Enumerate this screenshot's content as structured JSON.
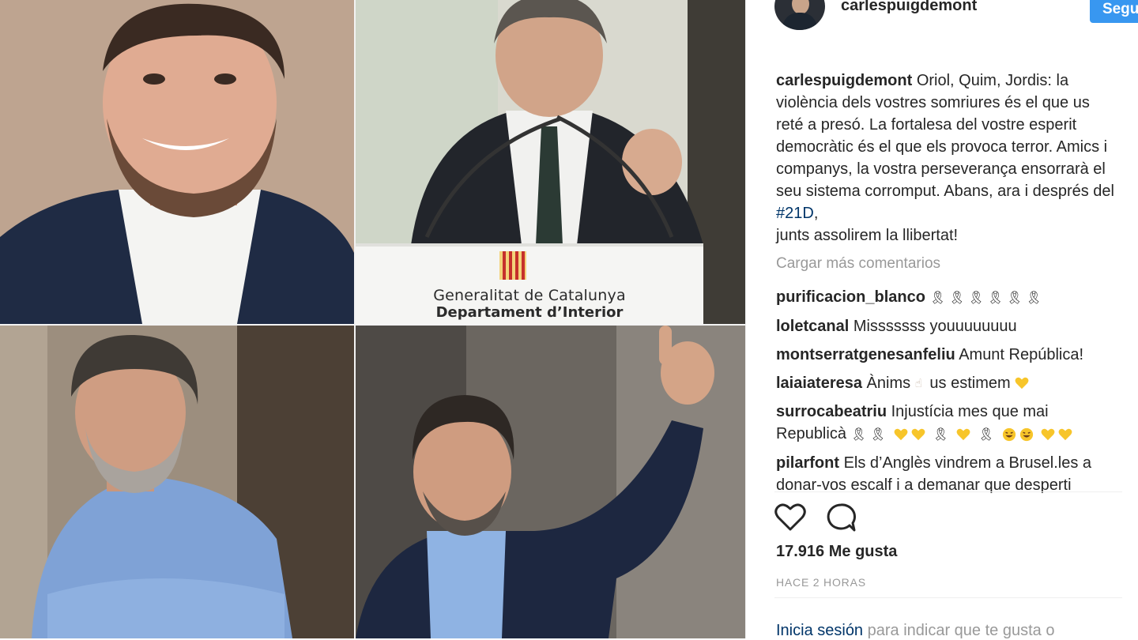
{
  "podium": {
    "line1": "Generalitat de Catalunya",
    "line2": "Departament d’Interior"
  },
  "post": {
    "username": "carlespuigdemont",
    "follow_label": "Seguir",
    "caption": {
      "username": "carlespuigdemont",
      "text": "Oriol, Quim, Jordis: la violència dels vostres somriures és el que us reté a presó. La fortalesa del vostre esperit democràtic és el que els provoca terror. Amics i companys, la vostra perseverança ensorrarà el seu sistema corromput. Abans, ara i després del ",
      "hashtag": "#21D",
      "text_after": ",\njunts assolirem la llibertat!"
    },
    "load_more": "Cargar más comentarios",
    "comments": [
      {
        "user": "purificacion_blanco",
        "text": ""
      },
      {
        "user": "loletcanal",
        "text": "Misssssss youuuuuuuu"
      },
      {
        "user": "montserratgenesanfeliu",
        "text": "Amunt República!"
      },
      {
        "user": "laiaiateresa",
        "text": "Ànims",
        "text_after": "us estimem"
      },
      {
        "user": "surrocabeatriu",
        "text": "Injustícia mes que mai",
        "text_line2": "Republicà"
      },
      {
        "user": "pilarfont",
        "text": "Els d’Anglès vindrem a Brusel.les a donar-vos escalf i a demanar que desperti"
      }
    ],
    "likes": "17.916 Me gusta",
    "time": "HACE 2 HORAS",
    "login_link": "Inicia sesión",
    "login_text": " para indicar que te gusta o"
  },
  "icons": {
    "like": "heart-outline-icon",
    "comment": "speech-bubble-icon",
    "ribbon": "black-ribbon-emoji",
    "heart": "yellow-heart-emoji",
    "laugh": "laughing-face-emoji",
    "finger": "pointing-hand-emoji"
  },
  "colors": {
    "follow_button": "#3897f0",
    "hashtag": "#003569",
    "muted": "#999999",
    "text": "#262626",
    "yellow_heart": "#f7c52a"
  }
}
